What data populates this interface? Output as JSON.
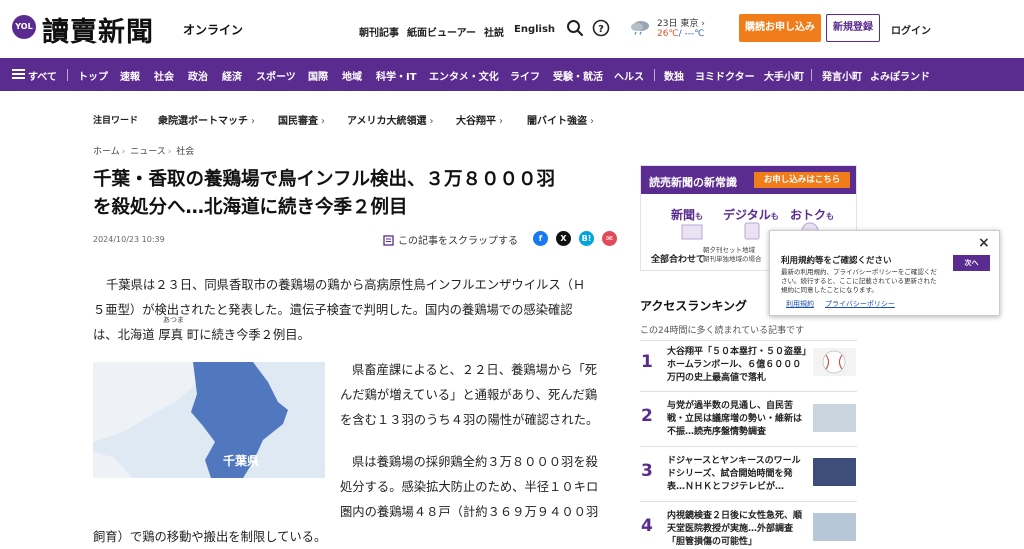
{
  "header": {
    "logo_badge": "YOL",
    "logo_name": "讀賣新聞",
    "logo_suffix": "オンライン",
    "nav": [
      "朝刊記事",
      "紙面ビューアー",
      "社説",
      "English"
    ],
    "weather_line1": "23日 東京",
    "weather_high": "26℃",
    "weather_low": "/ ---℃",
    "subscribe_label": "購読お申し込み",
    "register_label": "新規登録",
    "login_label": "ログイン",
    "icons": [
      "search-icon",
      "help-icon",
      "weather-cloud-icon"
    ]
  },
  "nav": {
    "all_label": "すべて",
    "items": [
      "トップ",
      "速報",
      "社会",
      "政治",
      "経済",
      "スポーツ",
      "国際",
      "地域",
      "科学・IT",
      "エンタメ・文化",
      "ライフ",
      "受験・就活",
      "ヘルス",
      "数独",
      "ヨミドクター",
      "大手小町",
      "発言小町",
      "よみぽランド"
    ]
  },
  "trending": {
    "label": "注目ワード",
    "items": [
      "衆院選ボートマッチ",
      "国民審査",
      "アメリカ大統領選",
      "大谷翔平",
      "闇バイト強盗"
    ]
  },
  "article": {
    "breadcrumb": [
      "ホーム",
      "ニュース",
      "社会"
    ],
    "headline_line1": "千葉・香取の養鶏場で鳥インフル検出、３万８０００羽",
    "headline_line2": "を殺処分へ…北海道に続き今季２例目",
    "date": "2024/10/23 10:39",
    "scrap_label": "この記事をスクラップする",
    "share_icons": [
      "facebook-icon",
      "x-icon",
      "hatena-bookmark-icon",
      "mail-icon"
    ],
    "ruby": "あつま",
    "p1": [
      "千葉県は２３日、同県香取市の養鶏場の鶏から高病原性鳥インフルエンザウイルス（Ｈ",
      "５亜型）が検出されたと発表した。遺伝子検査で判明した。国内の養鶏場での感染確認",
      "は、北海道 厚真 町に続き今季２例目。"
    ],
    "p2": [
      "県畜産課によると、２２日、養鶏場から「死",
      "んだ鶏が増えている」と通報があり、死んだ鶏",
      "を含む１３羽のうち４羽の陽性が確認された。"
    ],
    "p3": [
      "県は養鶏場の採卵鶏全約３万８０００羽を殺",
      "処分する。感染拡大防止のため、半径１０キロ",
      "圏内の養鶏場４８戸（計約３６９万９４００羽",
      "飼育）で鶏の移動や搬出を制限している。"
    ],
    "map_label": "千葉県"
  },
  "ad": {
    "title": "読売新聞の新常識",
    "cta": "お申し込みはこちら",
    "word1": "新聞",
    "word2": "デジタル",
    "word3": "おトク",
    "particle": "も",
    "total": "全部合わせて",
    "note1": "朝夕刊セット地域",
    "note2": "朝刊単独地域の場合"
  },
  "ranking": {
    "title": "アクセスランキング",
    "subtitle": "この24時間に多く読まれている記事です",
    "items": [
      {
        "rank": "1",
        "text": "大谷翔平「５０本塁打・５０盗塁」ホームランボール、６億６０００万円の史上最高値で落札"
      },
      {
        "rank": "2",
        "text": "与党が過半数の見通し、自民苦戦・立民は議席増の勢い・維新は不振…読売序盤情勢調査"
      },
      {
        "rank": "3",
        "text": "ドジャースとヤンキースのワールドシリーズ、試合開始時間を発表…ＮＨＫとフジテレビが…"
      },
      {
        "rank": "4",
        "text": "内視鏡検査２日後に女性急死、順天堂医院教授が実施…外部調査「胆管損傷の可能性」"
      }
    ]
  },
  "consent": {
    "title": "利用規約等をご確認ください",
    "body": "最新の利用規約、プライバシーポリシーをご確認ください。続行すると、ここに記載されている更新された規約に同意したことになります。",
    "link1": "利用規約",
    "link2": "プライバシーポリシー",
    "next_label": "次へ",
    "close_label": "×"
  },
  "colors": {
    "brand": "#5b2c8f",
    "accent": "#f07c1a",
    "link": "#1a4fb5"
  }
}
